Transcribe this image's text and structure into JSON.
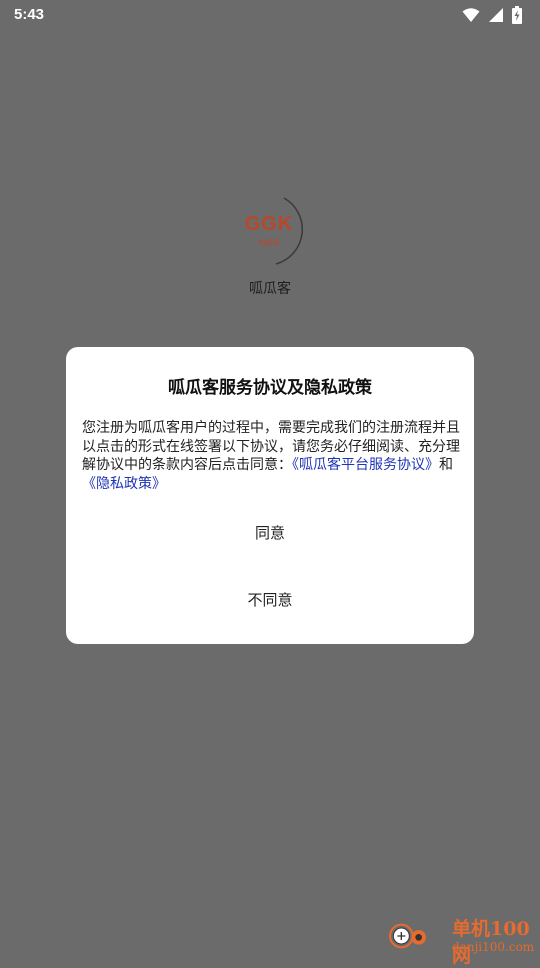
{
  "status_bar": {
    "time": "5:43",
    "icons": [
      "wifi-icon",
      "signal-icon",
      "battery-charging-icon"
    ]
  },
  "splash": {
    "logo_text": "GGK",
    "logo_subtext": "呱呱客",
    "app_name": "呱瓜客"
  },
  "dialog": {
    "title": "呱瓜客服务协议及隐私政策",
    "body_text": "您注册为呱瓜客用户的过程中，需要完成我们的注册流程并且以点击的形式在线签署以下协议，请您务必仔细阅读、充分理解协议中的条款内容后点击同意：",
    "link_service_agreement": "《呱瓜客平台服务协议》",
    "conjunction": "和",
    "link_privacy_policy": "《隐私政策》",
    "agree_label": "同意",
    "disagree_label": "不同意"
  },
  "watermark": {
    "brand": "单机100网",
    "url": "danji100.com"
  },
  "colors": {
    "overlay": "#6b6b6b",
    "link": "#1f35b5",
    "logo": "#b9472a",
    "watermark": "#e56b2e"
  }
}
